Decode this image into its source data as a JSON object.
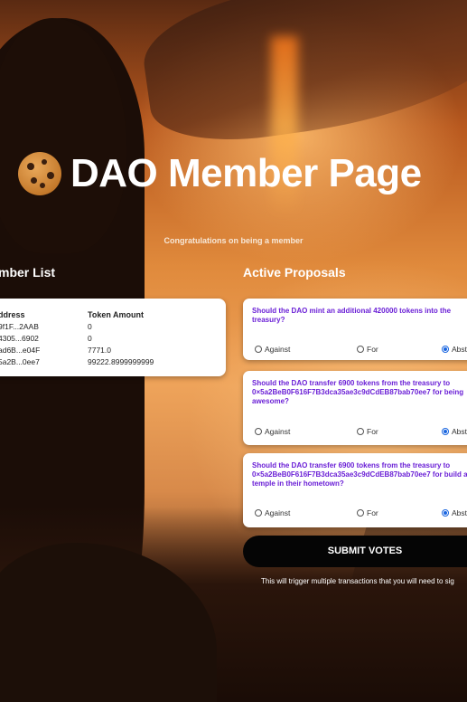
{
  "header": {
    "title": "DAO Member Page",
    "subtitle": "Congratulations on being a member"
  },
  "member_list": {
    "heading": "mber List",
    "columns": [
      "ddress",
      "Token Amount"
    ],
    "rows": [
      {
        "address": "9f1F...2AAB",
        "amount": "0"
      },
      {
        "address": "4305...6902",
        "amount": "0"
      },
      {
        "address": "ad6B...e04F",
        "amount": "7771.0"
      },
      {
        "address": "5a2B...0ee7",
        "amount": "99222.8999999999"
      }
    ]
  },
  "proposals": {
    "heading": "Active Proposals",
    "options": {
      "against": "Against",
      "for": "For",
      "abstain": "Abst"
    },
    "items": [
      {
        "question": "Should the DAO mint an additional 420000 tokens into the treasury?",
        "selected": "abstain"
      },
      {
        "question": "Should the DAO transfer 6900 tokens from the treasury to 0×5a2BeB0F616F7B3dca35ae3c9dCdEB87bab70ee7 for being awesome?",
        "selected": "abstain"
      },
      {
        "question": "Should the DAO transfer 6900 tokens from the treasury to 0×5a2BeB0F616F7B3dca35ae3c9dCdEB87bab70ee7 for build a temple in their hometown?",
        "selected": "abstain"
      }
    ]
  },
  "submit": {
    "label": "SUBMIT VOTES",
    "note": "This will trigger multiple transactions that you will need to sig"
  },
  "icons": {
    "logo": "cookie-icon"
  },
  "colors": {
    "question_text": "#6a1fd6",
    "button_bg": "#050505",
    "radio_selected": "#1a66e0"
  }
}
